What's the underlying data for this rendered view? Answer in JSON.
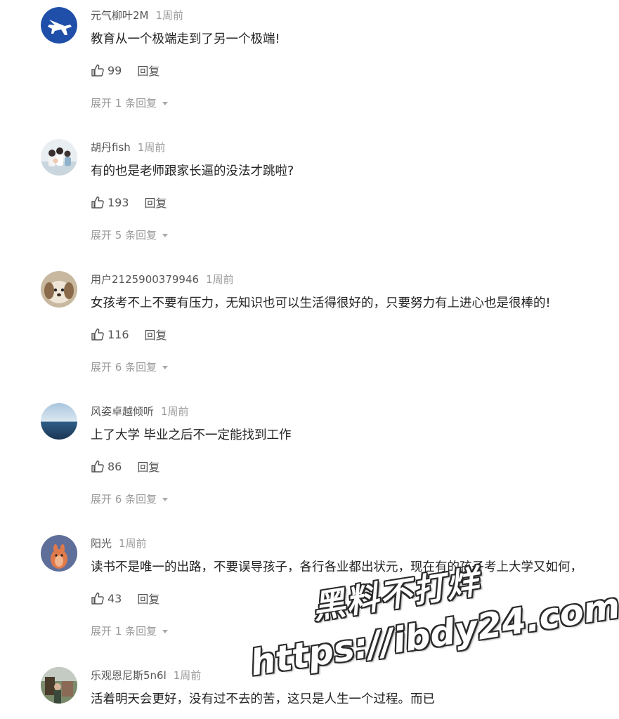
{
  "comments": [
    {
      "user": "元气柳叶2M",
      "time": "1周前",
      "text": "教育从一个极端走到了另一个极端!",
      "likes": "99",
      "reply_label": "回复",
      "expand_label": "展开 1 条回复",
      "avatar": "jet-plane"
    },
    {
      "user": "胡丹fish",
      "time": "1周前",
      "text": "有的也是老师跟家长逼的没法才跳啦?",
      "likes": "193",
      "reply_label": "回复",
      "expand_label": "展开 5 条回复",
      "avatar": "group-photo"
    },
    {
      "user": "用户2125900379946",
      "time": "1周前",
      "text": "女孩考不上不要有压力，无知识也可以生活得很好的，只要努力有上进心也是很棒的!",
      "likes": "116",
      "reply_label": "回复",
      "expand_label": "展开 6 条回复",
      "avatar": "dog"
    },
    {
      "user": "风姿卓越倾听",
      "time": "1周前",
      "text": "上了大学 毕业之后不一定能找到工作",
      "likes": "86",
      "reply_label": "回复",
      "expand_label": "展开 6 条回复",
      "avatar": "ocean"
    },
    {
      "user": "阳光",
      "time": "1周前",
      "text": "读书不是唯一的出路，不要误导孩子，各行各业都出状元，现在有的孩子考上大学又如何，",
      "likes": "43",
      "reply_label": "回复",
      "expand_label": "展开 1 条回复",
      "avatar": "cartoon"
    },
    {
      "user": "乐观恩尼斯5n6l",
      "time": "1周前",
      "text": "活着明天会更好，没有过不去的苦，这只是人生一个过程。而已",
      "likes": "",
      "reply_label": "",
      "expand_label": "",
      "avatar": "outdoor-photo"
    }
  ],
  "watermark": {
    "line1": "黑料不打烊",
    "line2": "https://ibdy24.com"
  },
  "colors": {
    "text": "#222222",
    "username": "#555555",
    "muted": "#999999"
  }
}
